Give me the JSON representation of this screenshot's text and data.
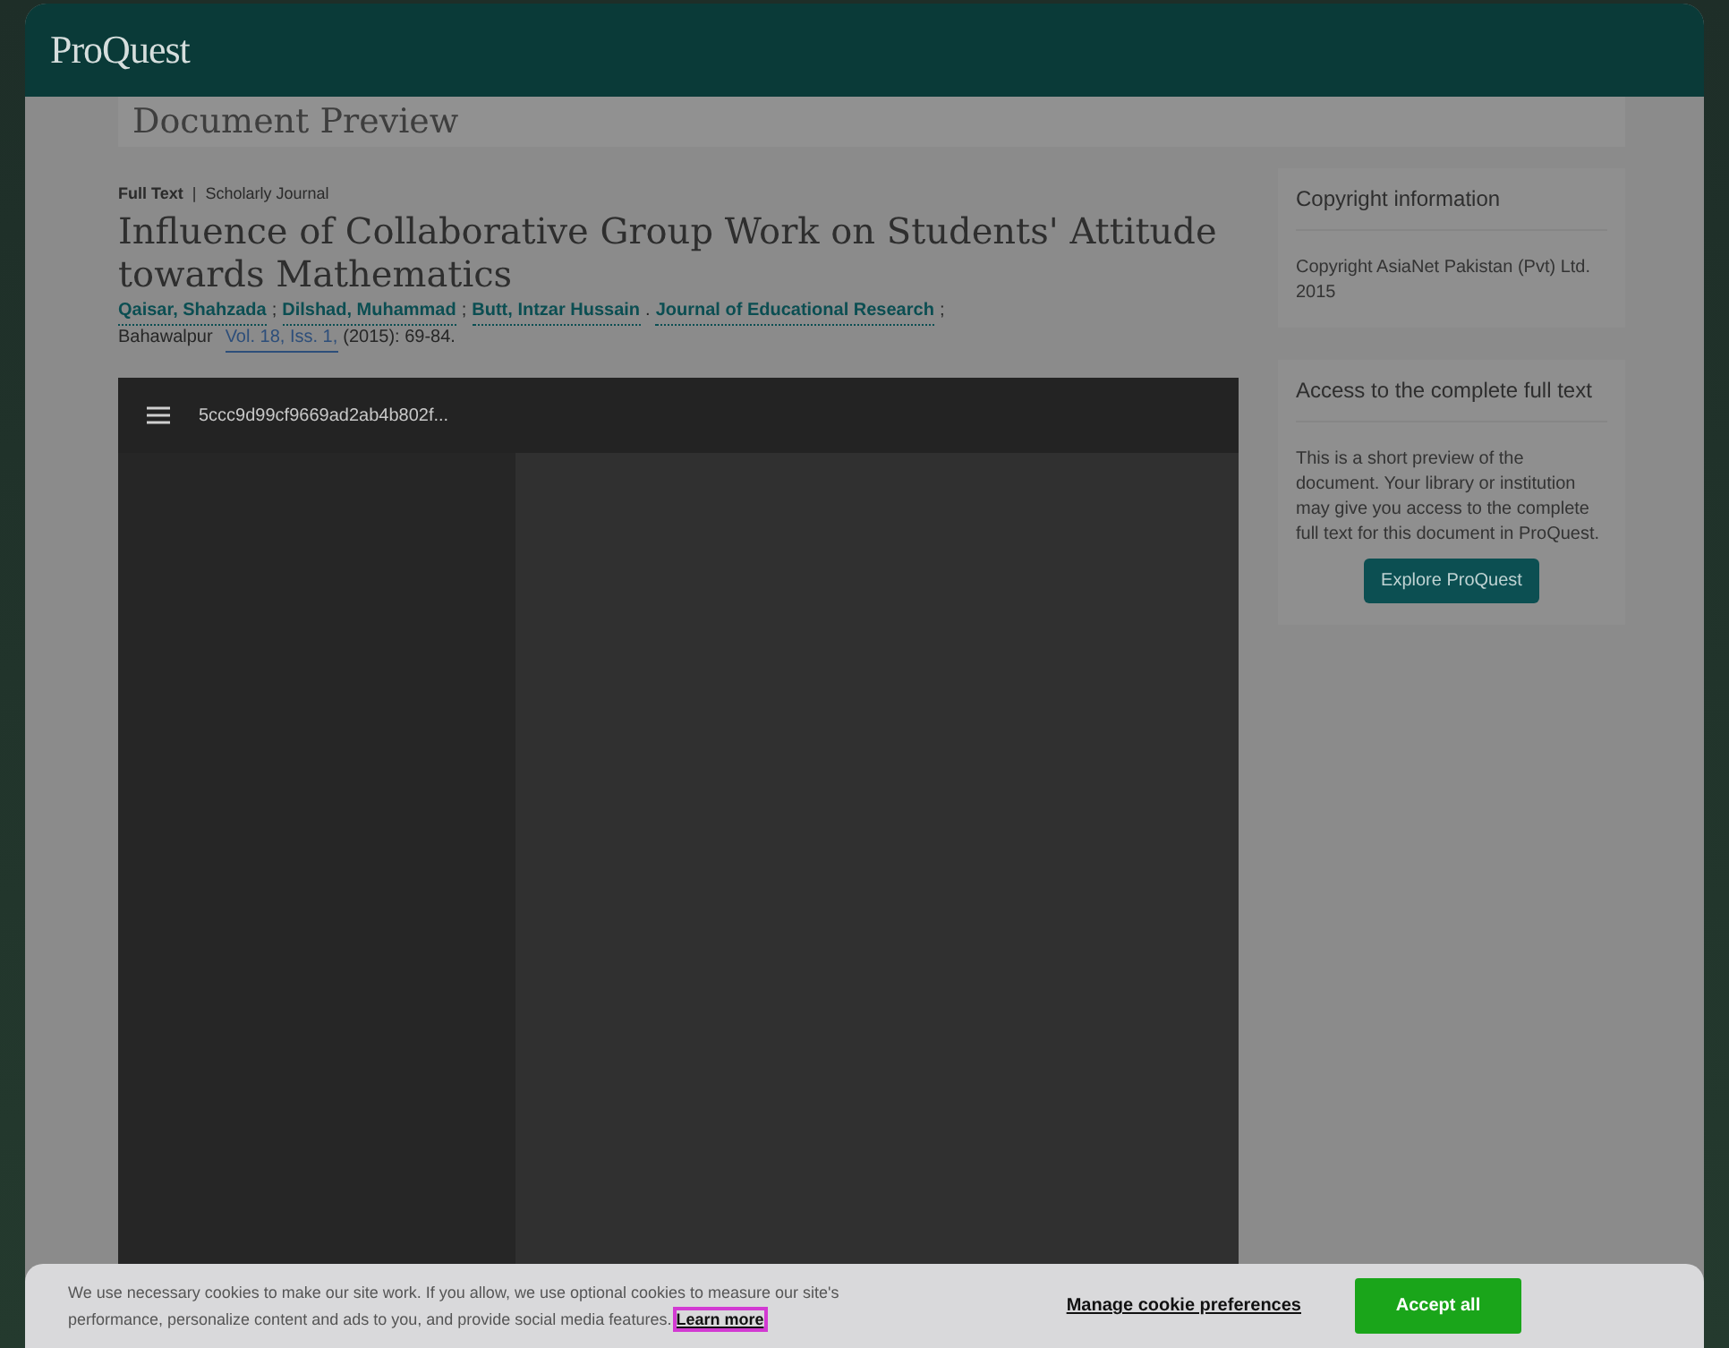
{
  "header": {
    "logo": "ProQuest"
  },
  "page_title": "Document Preview",
  "document": {
    "type": "Full Text",
    "type_separator": "|",
    "source_type": "Scholarly Journal",
    "title": "Influence of Collaborative Group Work on Students' Attitude towards Mathematics",
    "authors": [
      {
        "name": "Qaisar, Shahzada",
        "sep": ";"
      },
      {
        "name": "Dilshad, Muhammad",
        "sep": ";"
      },
      {
        "name": "Butt, Intzar Hussain",
        "sep": "."
      }
    ],
    "journal": "Journal of Educational Research",
    "journal_sep": ";",
    "place": "Bahawalpur",
    "volume": "Vol. 18, Iss. 1,",
    "date_pages": "(2015): 69-84."
  },
  "viewer": {
    "file_name": "5ccc9d99cf9669ad2ab4b802f..."
  },
  "sidebar": [
    {
      "heading": "Copyright information",
      "text": "Copyright AsiaNet Pakistan (Pvt) Ltd. 2015"
    },
    {
      "heading": "Access to the complete full text",
      "text": "This is a short preview of the document. Your library or institution may give you access to the complete full text for this document in ProQuest.",
      "button": "Explore ProQuest"
    }
  ],
  "cookie_banner": {
    "text": "We use necessary cookies to make our site work. If you allow, we use optional cookies to measure our site's performance, personalize content and ads to you, and provide social media features.",
    "link": "Learn more",
    "manage": "Manage cookie preferences",
    "accept": "Accept all"
  }
}
